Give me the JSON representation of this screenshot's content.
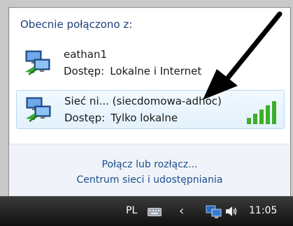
{
  "popup": {
    "heading": "Obecnie połączono z:",
    "connections": [
      {
        "name": "eathan1",
        "access_label": "Dostęp:",
        "access_value": "Lokalne i Internet"
      },
      {
        "name": "Sieć ni... (siecdomowa-adhoc)",
        "access_label": "Dostęp:",
        "access_value": "Tylko lokalne",
        "signal_icon": "signal-strength-icon"
      }
    ],
    "links": {
      "connect": "Połącz lub rozłącz...",
      "network_center": "Centrum sieci i udostępniania"
    }
  },
  "taskbar": {
    "language": "PL",
    "clock": "11:05"
  },
  "colors": {
    "link": "#1a4d8f",
    "heading": "#1e3f78",
    "signal_bars": "#3cae2b",
    "arrow": "#000000"
  }
}
